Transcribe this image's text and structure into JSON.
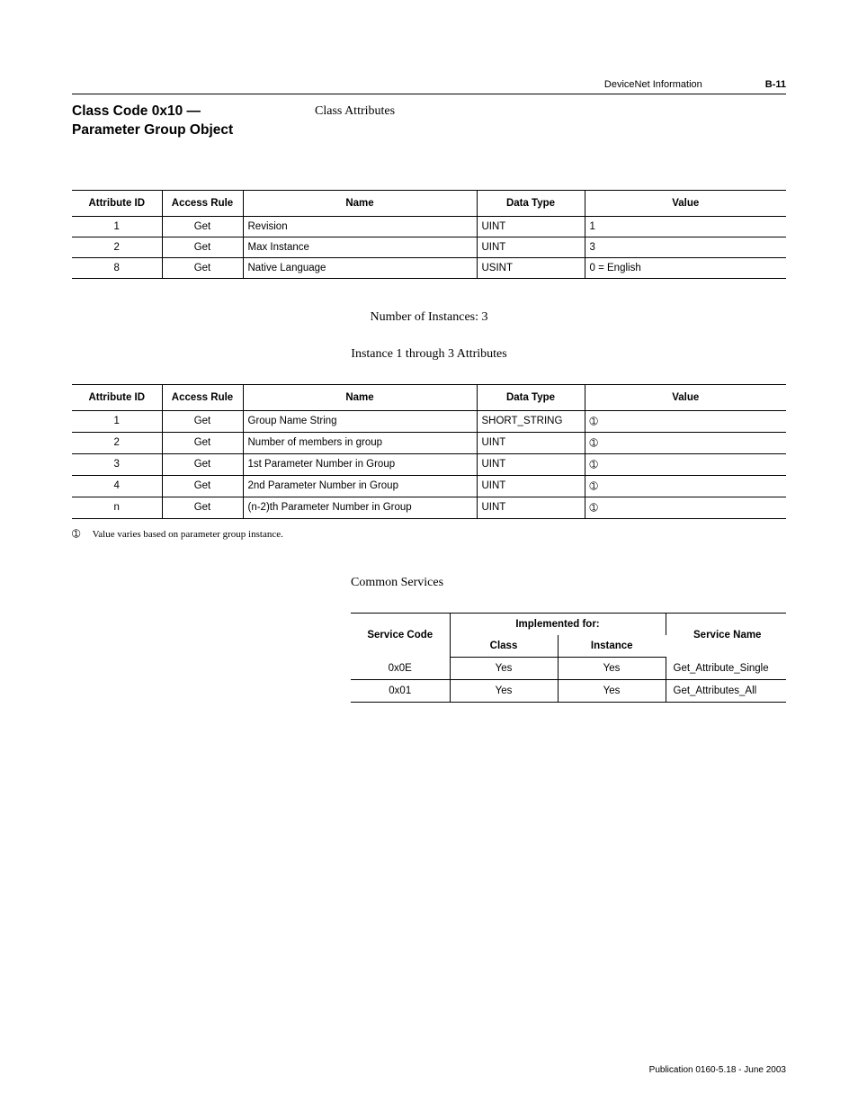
{
  "header": {
    "doc_title": "DeviceNet Information",
    "page_number": "B-11"
  },
  "title_section": {
    "left_line1": "Class Code 0x10 —",
    "left_line2": "Parameter Group Object",
    "right": "Class Attributes"
  },
  "table1": {
    "headers": {
      "attr_id": "Attribute ID",
      "access": "Access Rule",
      "name": "Name",
      "datatype": "Data Type",
      "value": "Value"
    },
    "rows": [
      {
        "attr_id": "1",
        "access": "Get",
        "name": "Revision",
        "datatype": "UINT",
        "value": "1"
      },
      {
        "attr_id": "2",
        "access": "Get",
        "name": "Max Instance",
        "datatype": "UINT",
        "value": "3"
      },
      {
        "attr_id": "8",
        "access": "Get",
        "name": "Native Language",
        "datatype": "USINT",
        "value": "0 = English"
      }
    ]
  },
  "mid_labels": {
    "instances": "Number of Instances: 3",
    "instance_attrs": "Instance 1 through 3 Attributes"
  },
  "table2": {
    "headers": {
      "attr_id": "Attribute ID",
      "access": "Access Rule",
      "name": "Name",
      "datatype": "Data Type",
      "value": "Value"
    },
    "rows": [
      {
        "attr_id": "1",
        "access": "Get",
        "name": "Group Name String",
        "datatype": "SHORT_STRING",
        "value": "➀"
      },
      {
        "attr_id": "2",
        "access": "Get",
        "name": "Number of members in group",
        "datatype": "UINT",
        "value": "➀"
      },
      {
        "attr_id": "3",
        "access": "Get",
        "name": "1st Parameter Number in Group",
        "datatype": "UINT",
        "value": "➀"
      },
      {
        "attr_id": "4",
        "access": "Get",
        "name": "2nd Parameter Number in Group",
        "datatype": "UINT",
        "value": "➀"
      },
      {
        "attr_id": "n",
        "access": "Get",
        "name": "(n-2)th Parameter Number in Group",
        "datatype": "UINT",
        "value": "➀"
      }
    ]
  },
  "footnote": {
    "symbol": "➀",
    "text": "Value varies based on parameter group instance."
  },
  "services_label": "Common Services",
  "table3": {
    "headers": {
      "service_code": "Service Code",
      "impl_for": "Implemented for:",
      "class": "Class",
      "instance": "Instance",
      "service_name": "Service Name"
    },
    "rows": [
      {
        "code": "0x0E",
        "class": "Yes",
        "instance": "Yes",
        "name": "Get_Attribute_Single"
      },
      {
        "code": "0x01",
        "class": "Yes",
        "instance": "Yes",
        "name": "Get_Attributes_All"
      }
    ]
  },
  "footer": {
    "publication": "Publication 0160-5.18 - June 2003"
  }
}
